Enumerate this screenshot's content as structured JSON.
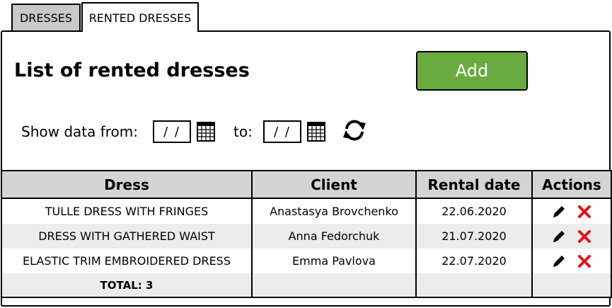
{
  "tabs": [
    {
      "label": "DRESSES"
    },
    {
      "label": "RENTED DRESSES"
    }
  ],
  "page": {
    "title": "List of rented dresses",
    "add_label": "Add"
  },
  "filter": {
    "from_label": "Show data from:",
    "to_label": "to:",
    "from_value": "/ /",
    "to_value": "/ /"
  },
  "table": {
    "headers": [
      "Dress",
      "Client",
      "Rental date",
      "Actions"
    ],
    "rows": [
      {
        "dress": "TULLE DRESS WITH FRINGES",
        "client": "Anastasya Brovchenko",
        "date": "22.06.2020"
      },
      {
        "dress": "DRESS WITH GATHERED WAIST",
        "client": "Anna Fedorchuk",
        "date": "21.07.2020"
      },
      {
        "dress": "ELASTIC TRIM EMBROIDERED DRESS",
        "client": "Emma Pavlova",
        "date": "22.07.2020"
      }
    ],
    "total": "TOTAL: 3"
  },
  "icons": {
    "edit": "pencil-icon",
    "delete": "close-icon",
    "calendar": "calendar-icon",
    "refresh": "refresh-icon"
  },
  "colors": {
    "accent": "#6aab40",
    "delete": "#e0131b",
    "header_bg": "#d4d4d4",
    "row_alt": "#ececec"
  }
}
